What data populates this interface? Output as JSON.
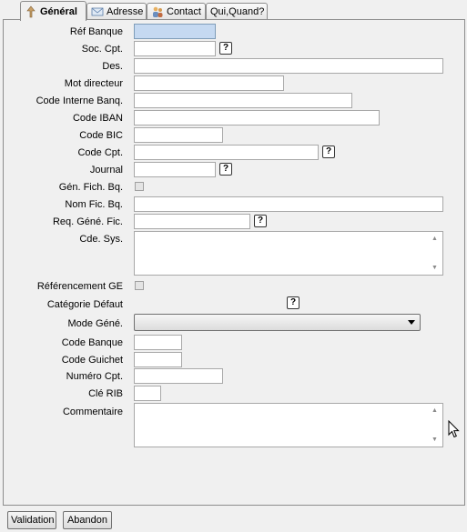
{
  "tabs": [
    {
      "label": "Général",
      "icon": "general-icon"
    },
    {
      "label": "Adresse",
      "icon": "envelope-icon"
    },
    {
      "label": "Contact",
      "icon": "people-icon"
    },
    {
      "label": "Qui,Quand?",
      "icon": ""
    }
  ],
  "form": {
    "ref_banque": "Réf Banque",
    "soc_cpt": "Soc. Cpt.",
    "des": "Des.",
    "mot_directeur": "Mot directeur",
    "code_interne": "Code Interne Banq.",
    "code_iban": "Code IBAN",
    "code_bic": "Code BIC",
    "code_cpt": "Code Cpt.",
    "journal": "Journal",
    "gen_fich": "Gén. Fich. Bq.",
    "nom_fic": "Nom Fic. Bq.",
    "req_gene": "Req. Géné. Fic.",
    "cde_sys": "Cde. Sys.",
    "referencement": "Référencement GE",
    "categorie": "Catégorie Défaut",
    "mode_gene": "Mode Géné.",
    "code_banque": "Code Banque",
    "code_guichet": "Code Guichet",
    "numero_cpt": "Numéro Cpt.",
    "cle_rib": "Clé RIB",
    "commentaire": "Commentaire"
  },
  "help_glyph": "?",
  "scroll": {
    "up": "▲",
    "down": "▼"
  },
  "buttons": {
    "validation": "Validation",
    "abandon": "Abandon"
  }
}
